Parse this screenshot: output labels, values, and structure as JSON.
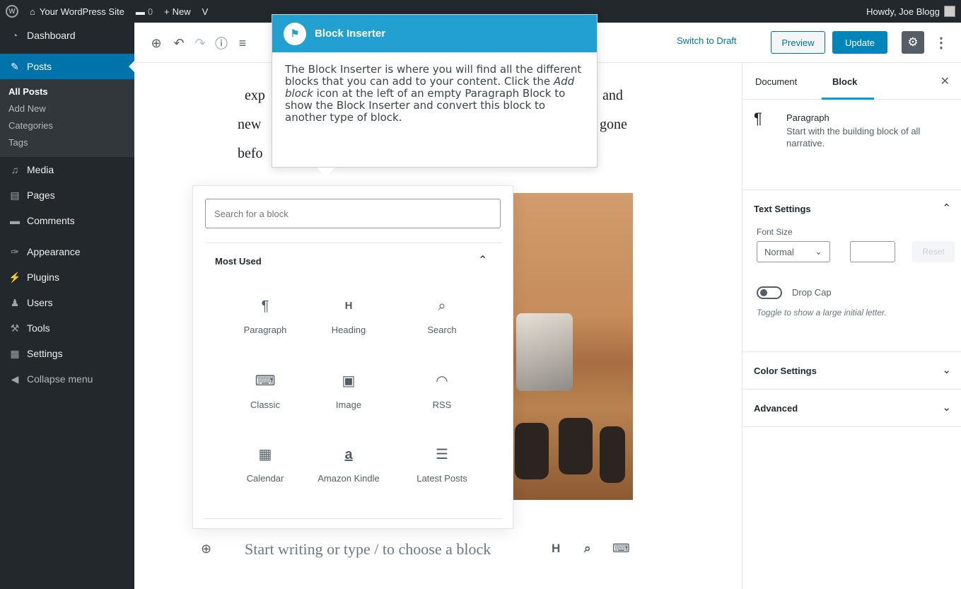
{
  "adminbar": {
    "site_name": "Your WordPress Site",
    "comments_count": "0",
    "new_label": "New",
    "view_label": "V",
    "howdy": "Howdy, Joe Blogg"
  },
  "sidebar": {
    "items": [
      {
        "label": "Dashboard",
        "icon": "dashboard-icon",
        "glyph": "◔"
      },
      {
        "label": "Posts",
        "icon": "pin-icon",
        "glyph": "✎"
      },
      {
        "label": "Media",
        "icon": "media-icon",
        "glyph": "♫"
      },
      {
        "label": "Pages",
        "icon": "pages-icon",
        "glyph": "▤"
      },
      {
        "label": "Comments",
        "icon": "comments-icon",
        "glyph": "▬"
      },
      {
        "label": "Appearance",
        "icon": "brush-icon",
        "glyph": "✑"
      },
      {
        "label": "Plugins",
        "icon": "plugin-icon",
        "glyph": "⚡"
      },
      {
        "label": "Users",
        "icon": "users-icon",
        "glyph": "♟"
      },
      {
        "label": "Tools",
        "icon": "wrench-icon",
        "glyph": "⚒"
      },
      {
        "label": "Settings",
        "icon": "settings-icon",
        "glyph": "▦"
      },
      {
        "label": "Collapse menu",
        "icon": "collapse-icon",
        "glyph": "◀"
      }
    ],
    "posts_submenu": [
      "All Posts",
      "Add New",
      "Categories",
      "Tags"
    ]
  },
  "header": {
    "switch_to_draft": "Switch to Draft",
    "preview": "Preview",
    "update": "Update"
  },
  "content": {
    "line1_start": "exp",
    "line1_end": "and",
    "line2_start": "new",
    "line2_end": "gone",
    "line3_start": "befo",
    "placeholder": "Start writing or type / to choose a block"
  },
  "inserter": {
    "search_placeholder": "Search for a block",
    "panel_title": "Most Used",
    "blocks": [
      {
        "label": "Paragraph",
        "icon": "paragraph-icon",
        "glyph": "¶"
      },
      {
        "label": "Heading",
        "icon": "heading-icon",
        "glyph": "H"
      },
      {
        "label": "Search",
        "icon": "search-icon",
        "glyph": "⌕"
      },
      {
        "label": "Classic",
        "icon": "keyboard-icon",
        "glyph": "⌨"
      },
      {
        "label": "Image",
        "icon": "image-icon",
        "glyph": "▣"
      },
      {
        "label": "RSS",
        "icon": "rss-icon",
        "glyph": "◠"
      },
      {
        "label": "Calendar",
        "icon": "calendar-icon",
        "glyph": "▦"
      },
      {
        "label": "Amazon Kindle",
        "icon": "amazon-icon",
        "glyph": "a"
      },
      {
        "label": "Latest Posts",
        "icon": "list-icon",
        "glyph": "☰"
      }
    ]
  },
  "tooltip": {
    "title": "Block Inserter",
    "body_before": "The Block Inserter is where you will find all the different blocks that you can add to your content. Click the ",
    "body_em": "Add block",
    "body_after": " icon at the left of an empty Paragraph Block to show the Block Inserter and convert this block to another type of block."
  },
  "settings": {
    "tab_document": "Document",
    "tab_block": "Block",
    "block_name": "Paragraph",
    "block_desc": "Start with the building block of all narrative.",
    "text_settings": "Text Settings",
    "font_size_label": "Font Size",
    "font_size_value": "Normal",
    "reset": "Reset",
    "drop_cap": "Drop Cap",
    "drop_cap_help": "Toggle to show a large initial letter.",
    "color_settings": "Color Settings",
    "advanced": "Advanced"
  },
  "colors": {
    "admin_dark": "#23282d",
    "accent_blue": "#0073aa",
    "tooltip_blue": "#23a0d2"
  }
}
